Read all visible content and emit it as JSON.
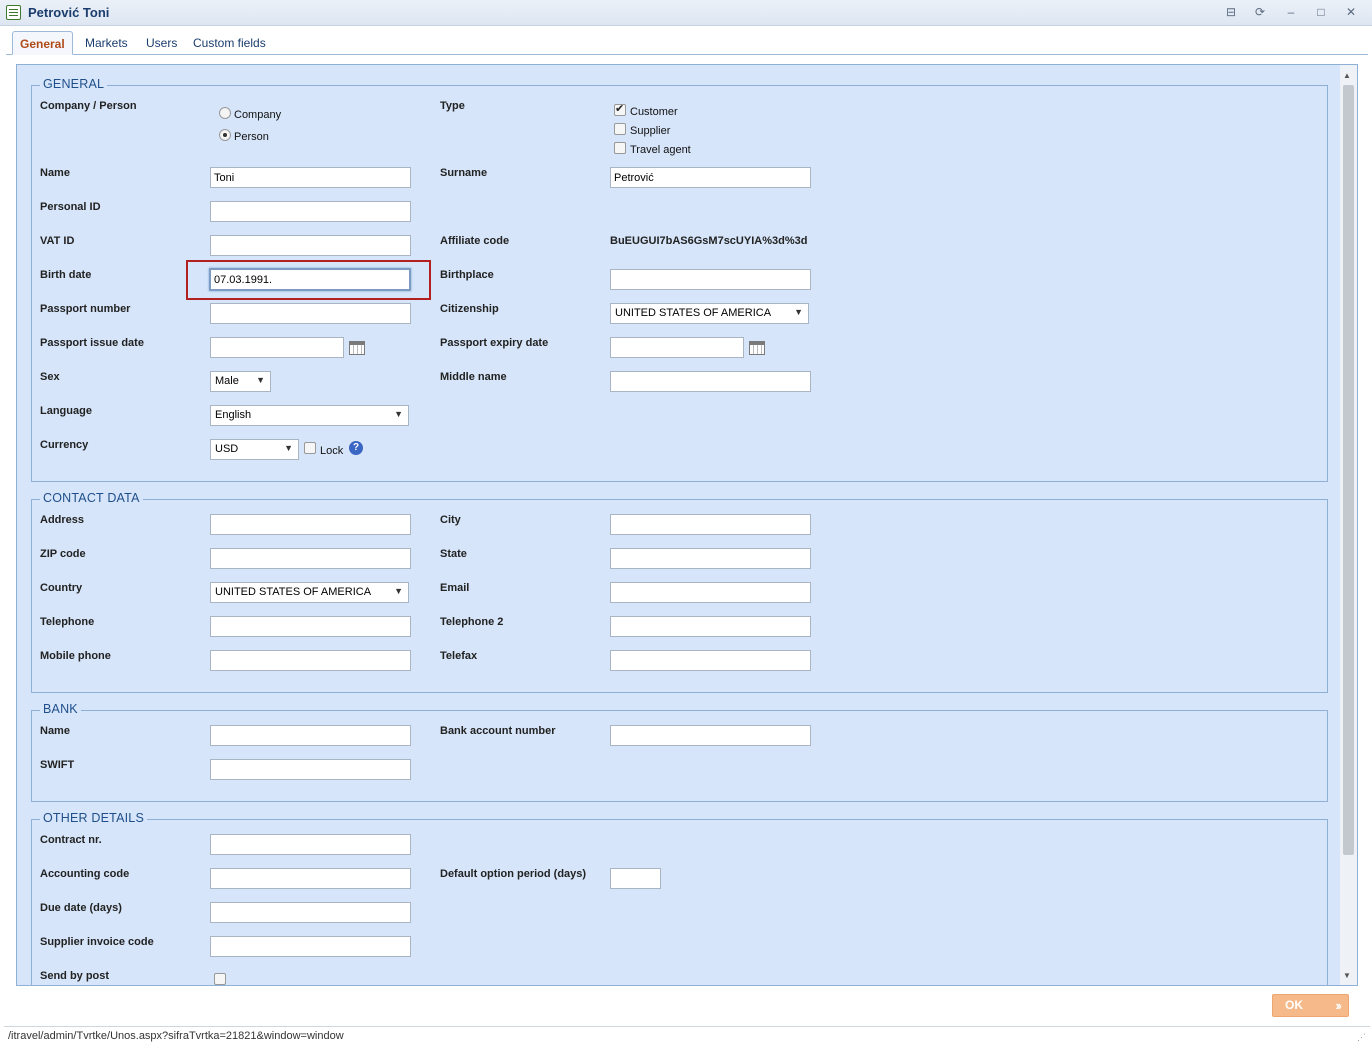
{
  "window": {
    "title": "Petrović Toni",
    "controls": [
      "pin-icon",
      "refresh-icon",
      "minimize-icon",
      "maximize-icon",
      "close-icon"
    ]
  },
  "tabs": [
    "General",
    "Markets",
    "Users",
    "Custom fields"
  ],
  "general": {
    "legend": "GENERAL",
    "company_person": {
      "label": "Company / Person",
      "options": [
        "Company",
        "Person"
      ],
      "selected": "Person"
    },
    "type": {
      "label": "Type",
      "options": [
        {
          "label": "Customer",
          "checked": true
        },
        {
          "label": "Supplier",
          "checked": false
        },
        {
          "label": "Travel agent",
          "checked": false
        }
      ]
    },
    "name": {
      "label": "Name",
      "value": "Toni"
    },
    "surname": {
      "label": "Surname",
      "value": "Petrović"
    },
    "personal_id": {
      "label": "Personal ID",
      "value": ""
    },
    "vat_id": {
      "label": "VAT ID",
      "value": ""
    },
    "affiliate_code": {
      "label": "Affiliate code",
      "value": "BuEUGUI7bAS6GsM7scUYIA%3d%3d"
    },
    "birth_date": {
      "label": "Birth date",
      "value": "07.03.1991."
    },
    "birthplace": {
      "label": "Birthplace",
      "value": ""
    },
    "passport_number": {
      "label": "Passport number",
      "value": ""
    },
    "citizenship": {
      "label": "Citizenship",
      "value": "UNITED STATES OF AMERICA"
    },
    "passport_issue_date": {
      "label": "Passport issue date",
      "value": ""
    },
    "passport_expiry_date": {
      "label": "Passport expiry date",
      "value": ""
    },
    "sex": {
      "label": "Sex",
      "value": "Male"
    },
    "middle_name": {
      "label": "Middle name",
      "value": ""
    },
    "language": {
      "label": "Language",
      "value": "English"
    },
    "currency": {
      "label": "Currency",
      "value": "USD",
      "lock_label": "Lock",
      "lock_checked": false
    }
  },
  "contact": {
    "legend": "CONTACT DATA",
    "address": {
      "label": "Address",
      "value": ""
    },
    "city": {
      "label": "City",
      "value": ""
    },
    "zip": {
      "label": "ZIP code",
      "value": ""
    },
    "state": {
      "label": "State",
      "value": ""
    },
    "country": {
      "label": "Country",
      "value": "UNITED STATES OF AMERICA"
    },
    "email": {
      "label": "Email",
      "value": ""
    },
    "telephone": {
      "label": "Telephone",
      "value": ""
    },
    "telephone2": {
      "label": "Telephone 2",
      "value": ""
    },
    "mobile": {
      "label": "Mobile phone",
      "value": ""
    },
    "telefax": {
      "label": "Telefax",
      "value": ""
    }
  },
  "bank": {
    "legend": "BANK",
    "name": {
      "label": "Name",
      "value": ""
    },
    "account": {
      "label": "Bank account number",
      "value": ""
    },
    "swift": {
      "label": "SWIFT",
      "value": ""
    }
  },
  "other": {
    "legend": "OTHER DETAILS",
    "contract": {
      "label": "Contract nr.",
      "value": ""
    },
    "accounting": {
      "label": "Accounting code",
      "value": ""
    },
    "option_period": {
      "label": "Default option period (days)",
      "value": ""
    },
    "due_date": {
      "label": "Due date (days)",
      "value": ""
    },
    "supplier_invoice": {
      "label": "Supplier invoice code",
      "value": ""
    },
    "send_by_post": {
      "label": "Send by post",
      "checked": false
    }
  },
  "ok_label": "OK",
  "status_url": "/itravel/admin/Tvrtke/Unos.aspx?sifraTvrtka=21821&window=window",
  "colors": {
    "panel_bg": "#d6e5f9",
    "legend": "#1f4f8b",
    "active_tab": "#b04a1b",
    "ok_button": "#f6b98a",
    "focus_highlight": "#b32020"
  }
}
